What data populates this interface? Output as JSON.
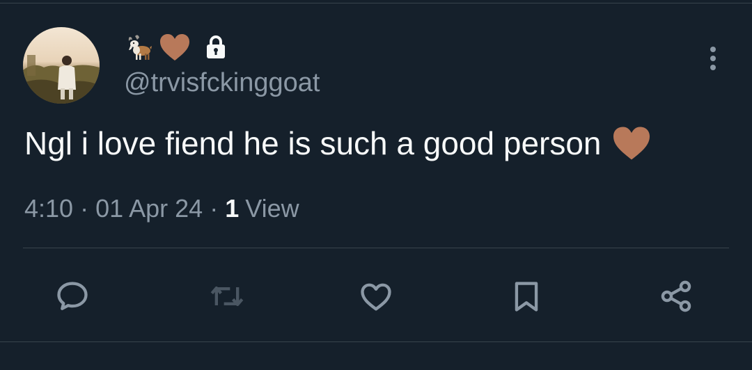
{
  "tweet": {
    "header": {
      "name_emojis": [
        "goat",
        "brown-heart"
      ],
      "locked": true,
      "handle": "@trvisfckinggoat"
    },
    "text": "Ngl i love fiend he is such a good person",
    "text_emoji": "brown-heart",
    "meta": {
      "time": "4:10",
      "separator": "·",
      "date": "01 Apr 24",
      "view_count": "1",
      "view_label": "View"
    },
    "actions": [
      {
        "name": "reply",
        "icon": "speech-bubble-icon"
      },
      {
        "name": "retweet",
        "icon": "retweet-icon"
      },
      {
        "name": "like",
        "icon": "heart-icon"
      },
      {
        "name": "bookmark",
        "icon": "bookmark-icon"
      },
      {
        "name": "share",
        "icon": "share-icon"
      }
    ]
  },
  "colors": {
    "background": "#15202b",
    "text_primary": "#f7f9f9",
    "text_secondary": "#8b98a5",
    "divider": "#38444d",
    "brown_heart": "#b8795a"
  }
}
